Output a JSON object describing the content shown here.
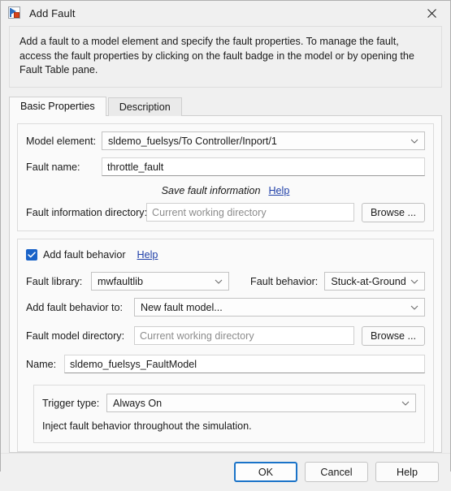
{
  "window": {
    "title": "Add Fault",
    "icon": "fault-badge-icon",
    "close_label": "✕"
  },
  "description": "Add a fault to a model element and specify the fault properties. To manage the fault, access the fault properties by clicking on the fault badge in the model or by opening the Fault Table pane.",
  "tabs": [
    {
      "label": "Basic Properties",
      "active": true
    },
    {
      "label": "Description",
      "active": false
    }
  ],
  "basic_properties": {
    "model_element": {
      "label": "Model element:",
      "value": "sldemo_fuelsys/To Controller/Inport/1"
    },
    "fault_name": {
      "label": "Fault name:",
      "value": "throttle_fault"
    },
    "save_fault_info": {
      "note": "Save fault information",
      "help_label": "Help"
    },
    "fault_info_directory": {
      "label": "Fault information directory:",
      "placeholder": "Current working directory",
      "value": "",
      "browse_label": "Browse ..."
    },
    "add_fault_behavior": {
      "label": "Add fault behavior",
      "checked": true,
      "help_label": "Help"
    },
    "fault_library": {
      "label": "Fault library:",
      "value": "mwfaultlib"
    },
    "fault_behavior": {
      "label": "Fault behavior:",
      "value": "Stuck-at-Ground"
    },
    "add_fault_behavior_to": {
      "label": "Add fault behavior to:",
      "value": "New fault model..."
    },
    "fault_model_directory": {
      "label": "Fault model directory:",
      "placeholder": "Current working directory",
      "value": "",
      "browse_label": "Browse ..."
    },
    "name": {
      "label": "Name:",
      "value": "sldemo_fuelsys_FaultModel"
    },
    "trigger": {
      "type_label": "Trigger type:",
      "type_value": "Always On",
      "hint": "Inject fault behavior throughout the simulation."
    }
  },
  "footer": {
    "ok_label": "OK",
    "cancel_label": "Cancel",
    "help_label": "Help"
  },
  "colors": {
    "accent": "#1a73c8",
    "link": "#1f3fa8",
    "checkbox": "#1a63c8",
    "window_bg": "#f0f0f0",
    "panel_bg": "#fafafa"
  }
}
